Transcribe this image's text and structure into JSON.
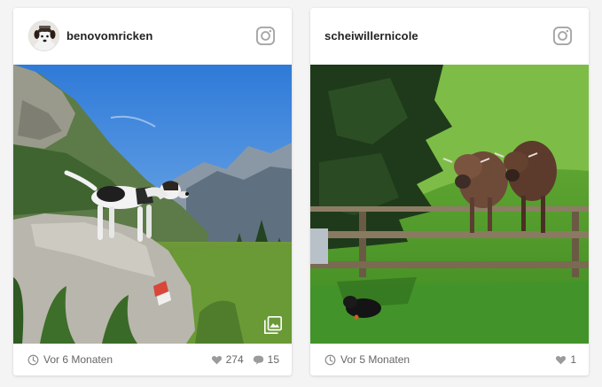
{
  "posts": [
    {
      "username": "benovomricken",
      "time": "Vor 6 Monaten",
      "likes": "274",
      "comments": "15",
      "has_avatar": true,
      "has_gallery_badge": true
    },
    {
      "username": "scheiwillernicole",
      "time": "Vor 5 Monaten",
      "likes": "1",
      "has_avatar": false,
      "has_gallery_badge": false
    }
  ],
  "icons": {
    "header": "instagram-icon",
    "time": "clock-icon",
    "likes": "heart-icon",
    "comments": "comment-icon",
    "gallery": "gallery-icon"
  },
  "colors": {
    "card_background": "#ffffff",
    "page_background": "#f4f4f4",
    "icon_gray": "#9b9b9b"
  }
}
